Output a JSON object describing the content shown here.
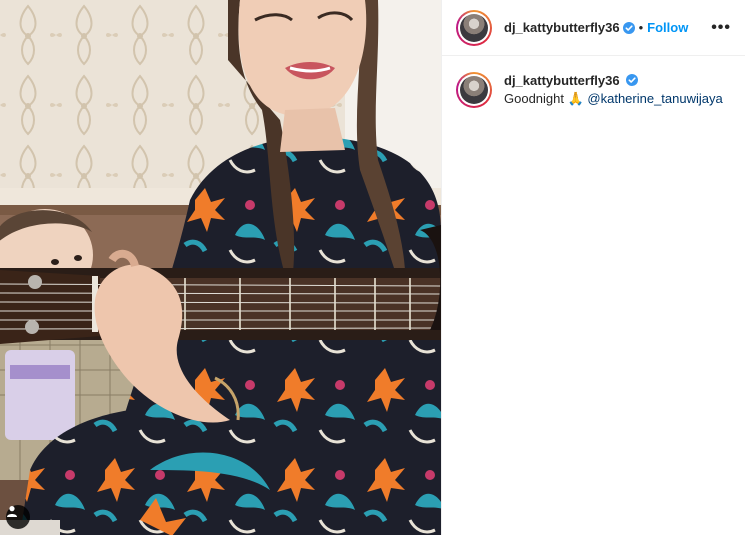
{
  "post": {
    "author": "dj_kattybutterfly36",
    "follow_label": "Follow",
    "separator": "•",
    "more_label": "•••",
    "caption_text": "Goodnight 🙏 ",
    "caption_mention": "@katherine_tanuwijaya"
  },
  "icons": {
    "verified": "verified-badge-icon",
    "more": "more-options-icon",
    "user_tag": "user-tag-icon"
  },
  "colors": {
    "accent": "#0095f6",
    "verified": "#3897f0",
    "mention": "#00376b"
  }
}
